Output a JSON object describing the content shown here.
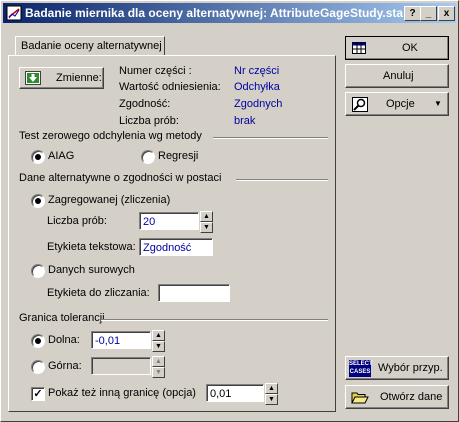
{
  "window": {
    "title": "Badanie miernika dla oceny alternatywnej: AttributeGageStudy.sta",
    "help_btn": "?",
    "min_btn": "_",
    "close_btn": "x"
  },
  "tab": {
    "label": "Badanie oceny alternatywnej"
  },
  "variables_button": "Zmienne:",
  "info": {
    "rows": [
      {
        "label": "Numer części :",
        "value": "Nr części"
      },
      {
        "label": "Wartość odniesienia:",
        "value": "Odchyłka"
      },
      {
        "label": "Zgodność:",
        "value": "Zgodnych"
      },
      {
        "label": "Liczba prób:",
        "value": "brak"
      }
    ]
  },
  "test_group": {
    "title": "Test zerowego odchylenia wg metody",
    "options": [
      "AIAG",
      "Regresji"
    ],
    "selected": "AIAG"
  },
  "data_group": {
    "title": "Dane alternatywne o zgodności w postaci",
    "option_grouped": "Zagregowanej (zliczenia)",
    "trials_label": "Liczba prób:",
    "trials_value": "20",
    "text_label": "Etykieta tekstowa:",
    "text_value": "Zgodność",
    "option_raw": "Danych surowych",
    "count_label": "Etykieta do zliczania:",
    "count_value": "",
    "selected": "Zagregowanej (zliczenia)"
  },
  "tolerance_group": {
    "title": "Granica tolerancji",
    "lower_label": "Dolna:",
    "lower_value": "-0,01",
    "upper_label": "Górna:",
    "upper_value": "",
    "selected": "Dolna",
    "show_other_label": "Pokaż też inną granicę (opcja)",
    "show_other_checked": true,
    "show_other_value": "0,01"
  },
  "buttons": {
    "ok": "OK",
    "cancel": "Anuluj",
    "options": "Opcje",
    "select_cases": "Wybór przyp.",
    "select_cases_icon_text_1": "SELECT",
    "select_cases_icon_text_2": "CASES",
    "open_data": "Otwórz dane"
  }
}
